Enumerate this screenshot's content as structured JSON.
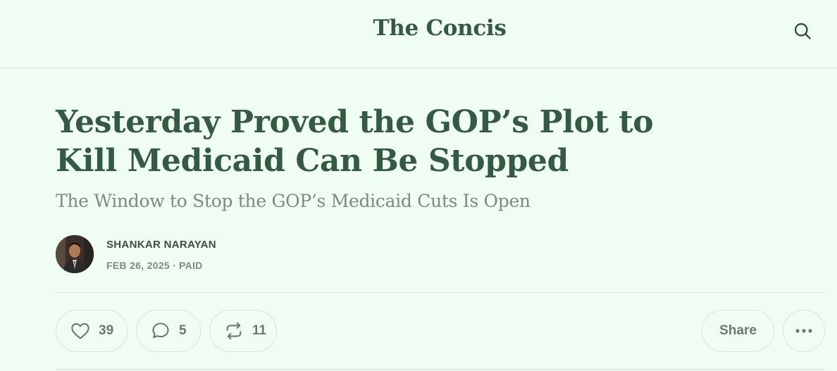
{
  "header": {
    "site_title": "The Concis",
    "search_icon": "search-icon"
  },
  "article": {
    "title": "Yesterday Proved the GOP’s Plot to Kill Medicaid Can Be Stopped",
    "subtitle": "The Window to Stop the GOP’s Medicaid Cuts Is Open",
    "author": "SHANKAR NARAYAN",
    "date": "FEB 26, 2025",
    "access": "PAID"
  },
  "actions": {
    "likes": "39",
    "comments": "5",
    "restacks": "11",
    "share_label": "Share",
    "icons": [
      "heart-icon",
      "comment-icon",
      "restack-icon",
      "more-icon"
    ]
  },
  "colors": {
    "background": "#effdf3",
    "title": "#355a43",
    "subtitle": "#7c8a80",
    "border": "#d8e4dc"
  }
}
